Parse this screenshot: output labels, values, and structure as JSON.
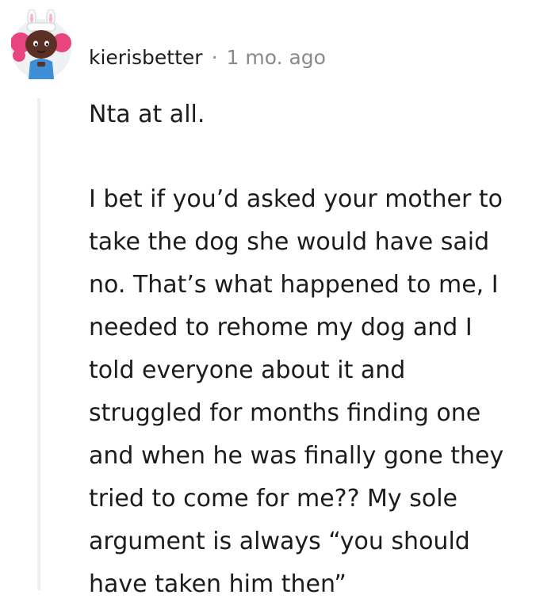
{
  "comment": {
    "username": "kierisbetter",
    "separator": "·",
    "age": "1 mo. ago",
    "avatar_icon": "snoo-avatar-icon",
    "paragraphs": [
      [
        "Nta at all."
      ],
      [
        "I bet if you’d asked your mother to",
        "take the dog she would have said",
        "no. That’s what happened to me, I",
        "needed to rehome my dog and I",
        "told everyone about it and",
        "struggled for months finding one",
        "and when he was finally gone they",
        "tried to come for me?? My sole",
        "argument is always “you should",
        "have taken him then”"
      ]
    ]
  },
  "colors": {
    "text": "#1c1c1c",
    "meta": "#878a8c",
    "thread_line": "#edeff1",
    "avatar_hair": "#e8457e",
    "avatar_skin": "#5a3124",
    "avatar_shirt": "#3f8fd6",
    "avatar_bg": "#eef1f3"
  }
}
